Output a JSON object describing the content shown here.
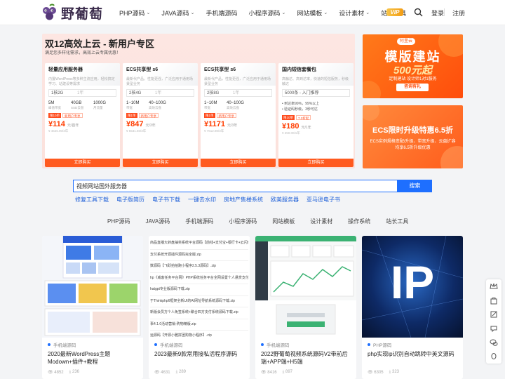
{
  "header": {
    "logo_text": "野葡萄",
    "nav": [
      {
        "label": "PHP源码",
        "dropdown": true
      },
      {
        "label": "JAVA源码",
        "dropdown": true
      },
      {
        "label": "手机端源码",
        "dropdown": false
      },
      {
        "label": "小程序源码",
        "dropdown": true
      },
      {
        "label": "网站模板",
        "dropdown": true
      },
      {
        "label": "设计素材",
        "dropdown": true
      },
      {
        "label": "站长工具",
        "dropdown": false
      }
    ],
    "vip": "VIP",
    "login": "登录",
    "register": "注册"
  },
  "promo": {
    "title": "双12高效上云 - 新用户专区",
    "subtitle": "满足您多样化需求，高效上云专属优惠！",
    "cards": [
      {
        "name": "轻量应用服务器",
        "desc": "内置WordPress等多种主流应用，轻松搞定学习、站建设等需求",
        "select": "1核2G",
        "select2": "1年",
        "specs": [
          [
            "5M",
            "峰值带宽"
          ],
          [
            "40GB",
            "SSD云盘"
          ],
          [
            "1000G",
            "月流量"
          ]
        ],
        "badges": [
          "限10单",
          "新用户专享"
        ],
        "price": "¥114",
        "unit": "元/首年",
        "orig": "¥ 4626.00/3年",
        "buy": "立即购买"
      },
      {
        "name": "ECS共享型 s6",
        "desc": "最新代产品，性能更强，广泛应用于通用场景型业务",
        "select": "2核4G",
        "select2": "1年",
        "specs": [
          [
            "1~10M",
            "带宽"
          ],
          [
            "40~100G",
            "高效云盘"
          ],
          [
            "",
            ""
          ]
        ],
        "badges": [
          "限1单",
          "新用户专享"
        ],
        "price": "¥847",
        "unit": "元/3年",
        "orig": "¥ 5531.60/3年",
        "buy": "立即购买"
      },
      {
        "name": "ECS共享型 s6",
        "desc": "最新代产品，性能更强，广泛应用于通用场景型业务",
        "select": "2核8G",
        "select2": "1年",
        "specs": [
          [
            "1~10M",
            "带宽"
          ],
          [
            "40~100G",
            "高效云盘"
          ],
          [
            "",
            ""
          ]
        ],
        "badges": [
          "限1单",
          "新用户专享"
        ],
        "price": "¥1171",
        "unit": "元/3年",
        "orig": "¥ 7612.80/3年",
        "buy": "立即购买"
      },
      {
        "name": "国内短信套餐包",
        "desc": "高触达、高到达率，快速的短信服务，秒级触达",
        "select": "5000条 - 入门推荐",
        "select2": "",
        "bullets": [
          "到达率99%，99%以上",
          "验证码秒级，3秒可达"
        ],
        "badges": [
          "限10单",
          "7.2折起"
        ],
        "price": "¥180",
        "unit": "元/1年",
        "orig": "¥ 250.00/1年",
        "buy": "立即购买"
      }
    ]
  },
  "ads": {
    "ad1_tag": "阿里云",
    "ad1_title": "模版建站",
    "ad1_price": "500元起",
    "ad1_sub": "定制建站  设计师1对1服务",
    "ad1_btn": "咨询有礼",
    "ad2_title": "ECS限时升级特惠6.5折",
    "ad2_sub": "ECS实例规格变配/升级、带宽升级、云盘扩容均享6.5折升级优惠"
  },
  "search": {
    "value": "视频网站国外服务器",
    "button": "搜索",
    "hot": [
      "修复工具下载",
      "电子版简历",
      "电子书下载",
      "一键去水印",
      "房地产售楼系统",
      "欧美服务器",
      "亚马逊电子书"
    ]
  },
  "tabs": [
    "PHP源码",
    "JAVA源码",
    "手机端源码",
    "小程序源码",
    "网站模板",
    "设计素材",
    "操作系统",
    "站长工具"
  ],
  "posts": [
    {
      "category": "手机端源码",
      "title": "2020最新WordPress主题Modown+插件+教程",
      "views": "4852",
      "downloads": "236"
    },
    {
      "category": "手机端源码",
      "title": "2023最新9款常用接私活程序源码",
      "views": "4631",
      "downloads": "289"
    },
    {
      "category": "手机端源码",
      "title": "2022野葡萄视频系统源码V2带前后端+APP端+H5端",
      "views": "8416",
      "downloads": "897"
    },
    {
      "category": "PHP源码",
      "title": "php实现ip识别自动跳转中英文源码",
      "views": "6305",
      "downloads": "323"
    }
  ],
  "post2_lines": [
    "商品直播大转盘抽奖系统平台源码【前线+支付宝+银行卡+云闪付】",
    "支付系统开源插件源码完全版.zip",
    "数源码【飞跃拍拍跑小程序2.5.3源码】.zip",
    "hp《威客任务平台网》PHP系统任务平台全网设置个人悬赏支付网站",
    "hatgpt专业版源码下载.zip",
    "于Thinkphp6框架全新UI的AI网址导航系统源码下载.zip",
    "新版会员方个人免签系统+聚合四方支付系统源码下载.zip",
    "事4.1.0活动营销-购物精版.zip",
    "运源码【开源小雅拼团购物小程序】.zip"
  ],
  "post4_overlay": "IP",
  "colors": {
    "accent": "#1e6fff",
    "orange": "#ff5a1f"
  }
}
